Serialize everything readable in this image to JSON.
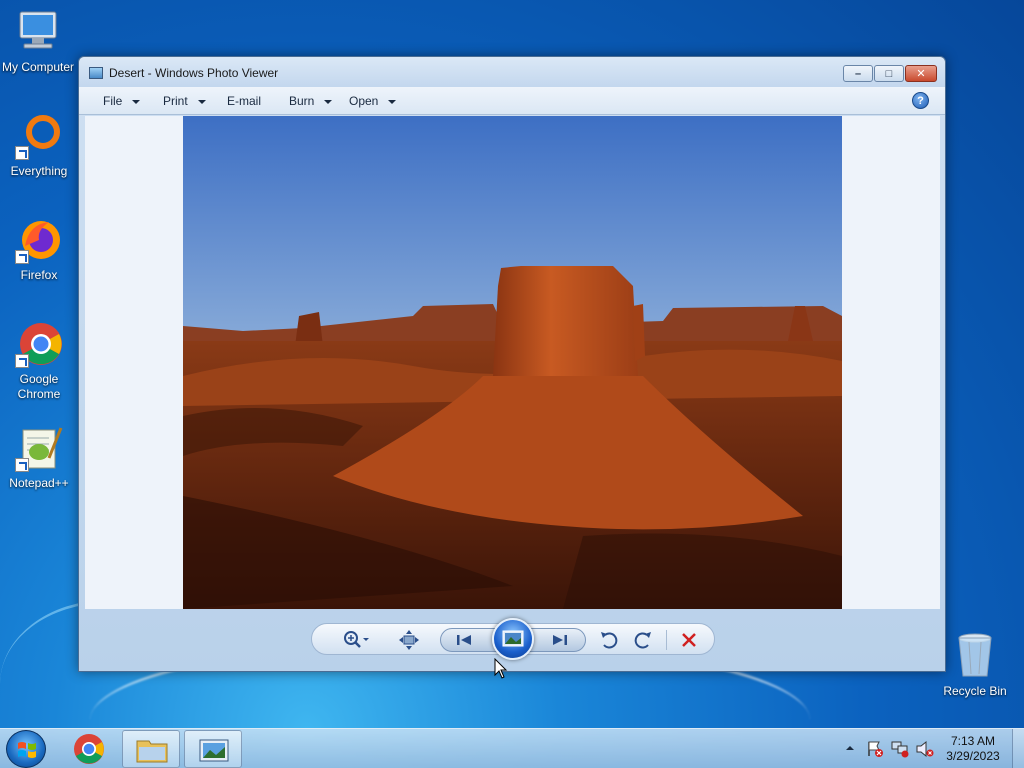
{
  "desktop": {
    "icons": [
      {
        "label": "My Computer"
      },
      {
        "label": "Everything"
      },
      {
        "label": "Firefox"
      },
      {
        "label": "Google Chrome"
      },
      {
        "label": "Notepad++"
      },
      {
        "label": "Recycle Bin"
      }
    ]
  },
  "window": {
    "title": "Desert - Windows Photo Viewer",
    "menu": {
      "file": "File",
      "print": "Print",
      "email": "E-mail",
      "burn": "Burn",
      "open": "Open"
    }
  },
  "controls": [
    {
      "name": "zoom",
      "icon": "magnifier-icon"
    },
    {
      "name": "actual-size",
      "icon": "fit-icon"
    },
    {
      "name": "previous",
      "icon": "previous-icon"
    },
    {
      "name": "slide-show",
      "icon": "slideshow-icon"
    },
    {
      "name": "next",
      "icon": "next-icon"
    },
    {
      "name": "rotate-counterclockwise",
      "icon": "rotate-left-icon"
    },
    {
      "name": "rotate-clockwise",
      "icon": "rotate-right-icon"
    },
    {
      "name": "delete",
      "icon": "delete-icon"
    }
  ],
  "taskbar": {
    "clock_time": "7:13 AM",
    "clock_date": "3/29/2023"
  },
  "colors": {
    "desktop_blue": "#0b62bf",
    "window_frame": "#cfe0f2",
    "delete_red": "#d02020"
  }
}
